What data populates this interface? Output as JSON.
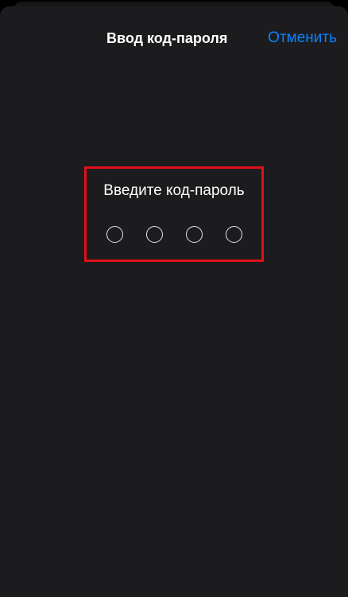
{
  "nav": {
    "title": "Ввод код-пароля",
    "cancel_label": "Отменить"
  },
  "passcode": {
    "prompt": "Введите код-пароль",
    "digits_total": 4,
    "digits_entered": 0
  },
  "colors": {
    "background": "#1c1c1e",
    "accent": "#0a84ff",
    "highlight": "#e0101d"
  }
}
